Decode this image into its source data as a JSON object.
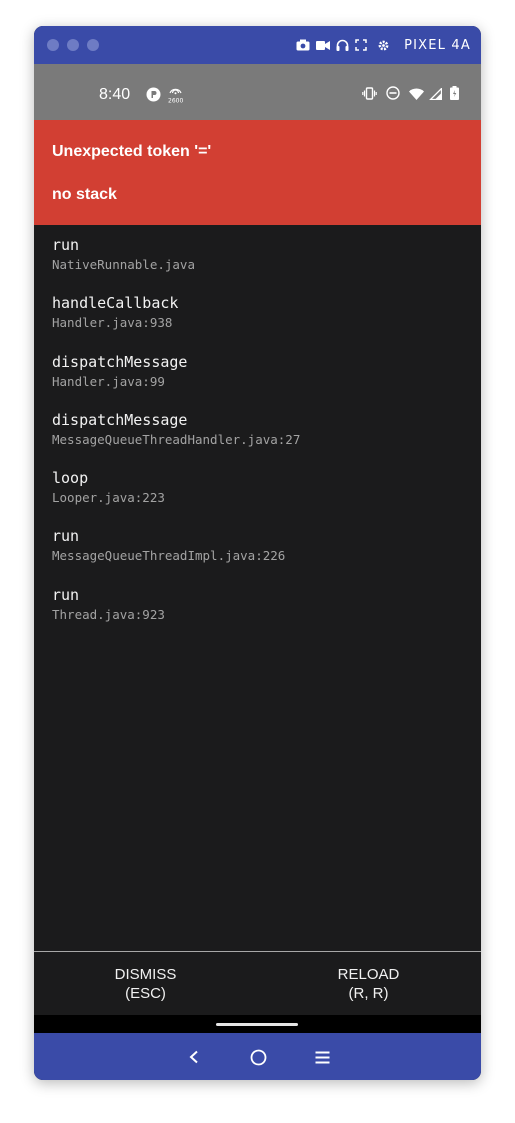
{
  "emulator": {
    "device_name": "PIXEL 4A",
    "toolbar_icons": [
      "camera-icon",
      "video-icon",
      "headphones-icon",
      "fullscreen-icon",
      "settings-icon"
    ],
    "window_dots": [
      "close",
      "minimize",
      "zoom"
    ],
    "nav_icons": [
      "back-icon",
      "home-icon",
      "menu-icon"
    ]
  },
  "status_bar": {
    "time": "8:40",
    "left_icons": [
      "app-notification-icon",
      "hotspot-icon"
    ],
    "right_icons": [
      "vibrate-icon",
      "do-not-disturb-icon",
      "wifi-icon",
      "signal-icon",
      "battery-icon"
    ]
  },
  "error": {
    "title": "Unexpected token '='",
    "subtitle": "no stack",
    "background": "#d23f33"
  },
  "stack_frames": [
    {
      "fn": "run",
      "file": "NativeRunnable.java"
    },
    {
      "fn": "handleCallback",
      "file": "Handler.java:938"
    },
    {
      "fn": "dispatchMessage",
      "file": "Handler.java:99"
    },
    {
      "fn": "dispatchMessage",
      "file": "MessageQueueThreadHandler.java:27"
    },
    {
      "fn": "loop",
      "file": "Looper.java:223"
    },
    {
      "fn": "run",
      "file": "MessageQueueThreadImpl.java:226"
    },
    {
      "fn": "run",
      "file": "Thread.java:923"
    }
  ],
  "buttons": {
    "dismiss": {
      "label": "DISMISS",
      "shortcut": "(ESC)"
    },
    "reload": {
      "label": "RELOAD",
      "shortcut": "(R, R)"
    }
  },
  "colors": {
    "emulator_chrome": "#3a4ba8",
    "status_bar": "#7a7a7a",
    "redbox": "#d23f33",
    "background": "#1b1b1c"
  }
}
